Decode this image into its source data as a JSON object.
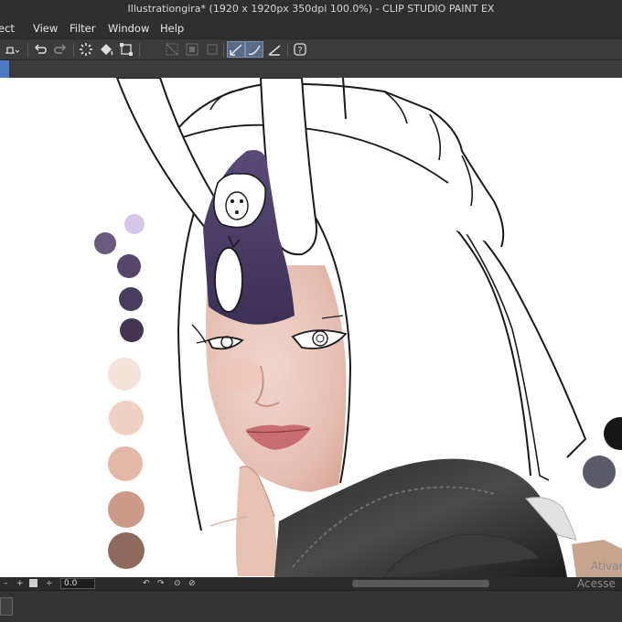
{
  "window": {
    "title": "Illustrationgira* (1920 x 1920px 350dpi 100.0%)  - CLIP STUDIO PAINT EX"
  },
  "menu": {
    "items": [
      "ect",
      "View",
      "Filter",
      "Window",
      "Help"
    ]
  },
  "toolbar": {
    "icons": [
      "layer-save-icon",
      "undo-icon",
      "redo-icon",
      "loading-icon",
      "fill-icon",
      "transform-icon",
      "deselect-icon",
      "invert-icon",
      "clear-icon",
      "stabilizer-icon",
      "curve-icon",
      "ruler-icon",
      "help-icon"
    ]
  },
  "status": {
    "zoom_value": "0.0"
  },
  "palette": {
    "colors": [
      "#d6c7e8",
      "#6a5a7e",
      "#55466a",
      "#4a3b60",
      "#43354f",
      "#f5e3dc",
      "#efd1c6",
      "#e2b8a8",
      "#cc9a88",
      "#8e6a5e"
    ],
    "right_colors": [
      "#161616",
      "#5b5b68"
    ]
  },
  "watermark": {
    "line1": "Ativar",
    "line2": "Acesse C"
  }
}
